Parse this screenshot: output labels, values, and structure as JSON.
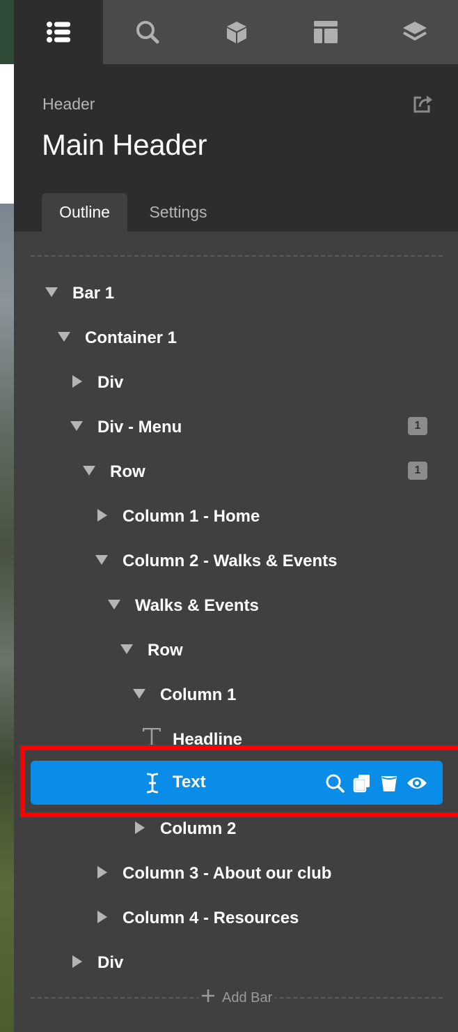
{
  "toolbar": {
    "icons": [
      "outline-list-icon",
      "search-icon",
      "box-icon",
      "layout-icon",
      "layers-icon"
    ],
    "active": "outline-list-icon"
  },
  "panel": {
    "kicker": "Header",
    "title": "Main Header",
    "tabs": [
      {
        "label": "Outline",
        "active": true
      },
      {
        "label": "Settings",
        "active": false
      }
    ]
  },
  "tree": [
    {
      "label": "Bar 1",
      "expanded": true
    },
    {
      "label": "Container 1",
      "expanded": true
    },
    {
      "label": "Div",
      "expanded": false
    },
    {
      "label": "Div - Menu",
      "expanded": true,
      "badge": "1"
    },
    {
      "label": "Row",
      "expanded": true,
      "badge": "1"
    },
    {
      "label": "Column 1 - Home",
      "expanded": false
    },
    {
      "label": "Column 2 - Walks & Events",
      "expanded": true
    },
    {
      "label": "Walks & Events",
      "expanded": true
    },
    {
      "label": "Row",
      "expanded": true
    },
    {
      "label": "Column 1",
      "expanded": true
    },
    {
      "label": "Headline",
      "icon": "text-heading-icon"
    },
    {
      "label": "Text",
      "icon": "text-cursor-icon",
      "selected": true
    },
    {
      "label": "Column 2",
      "expanded": false
    },
    {
      "label": "Column 3 - About our club",
      "expanded": false
    },
    {
      "label": "Column 4 - Resources",
      "expanded": false
    },
    {
      "label": "Div",
      "expanded": false
    }
  ],
  "selected_actions": [
    "search-icon",
    "copy-icon",
    "delete-icon",
    "eye-icon"
  ],
  "add_bar": "Add Bar",
  "colors": {
    "accent": "#0a8ce9",
    "highlight": "#ff0000",
    "panel": "#404040",
    "header": "#2d2d2d"
  }
}
